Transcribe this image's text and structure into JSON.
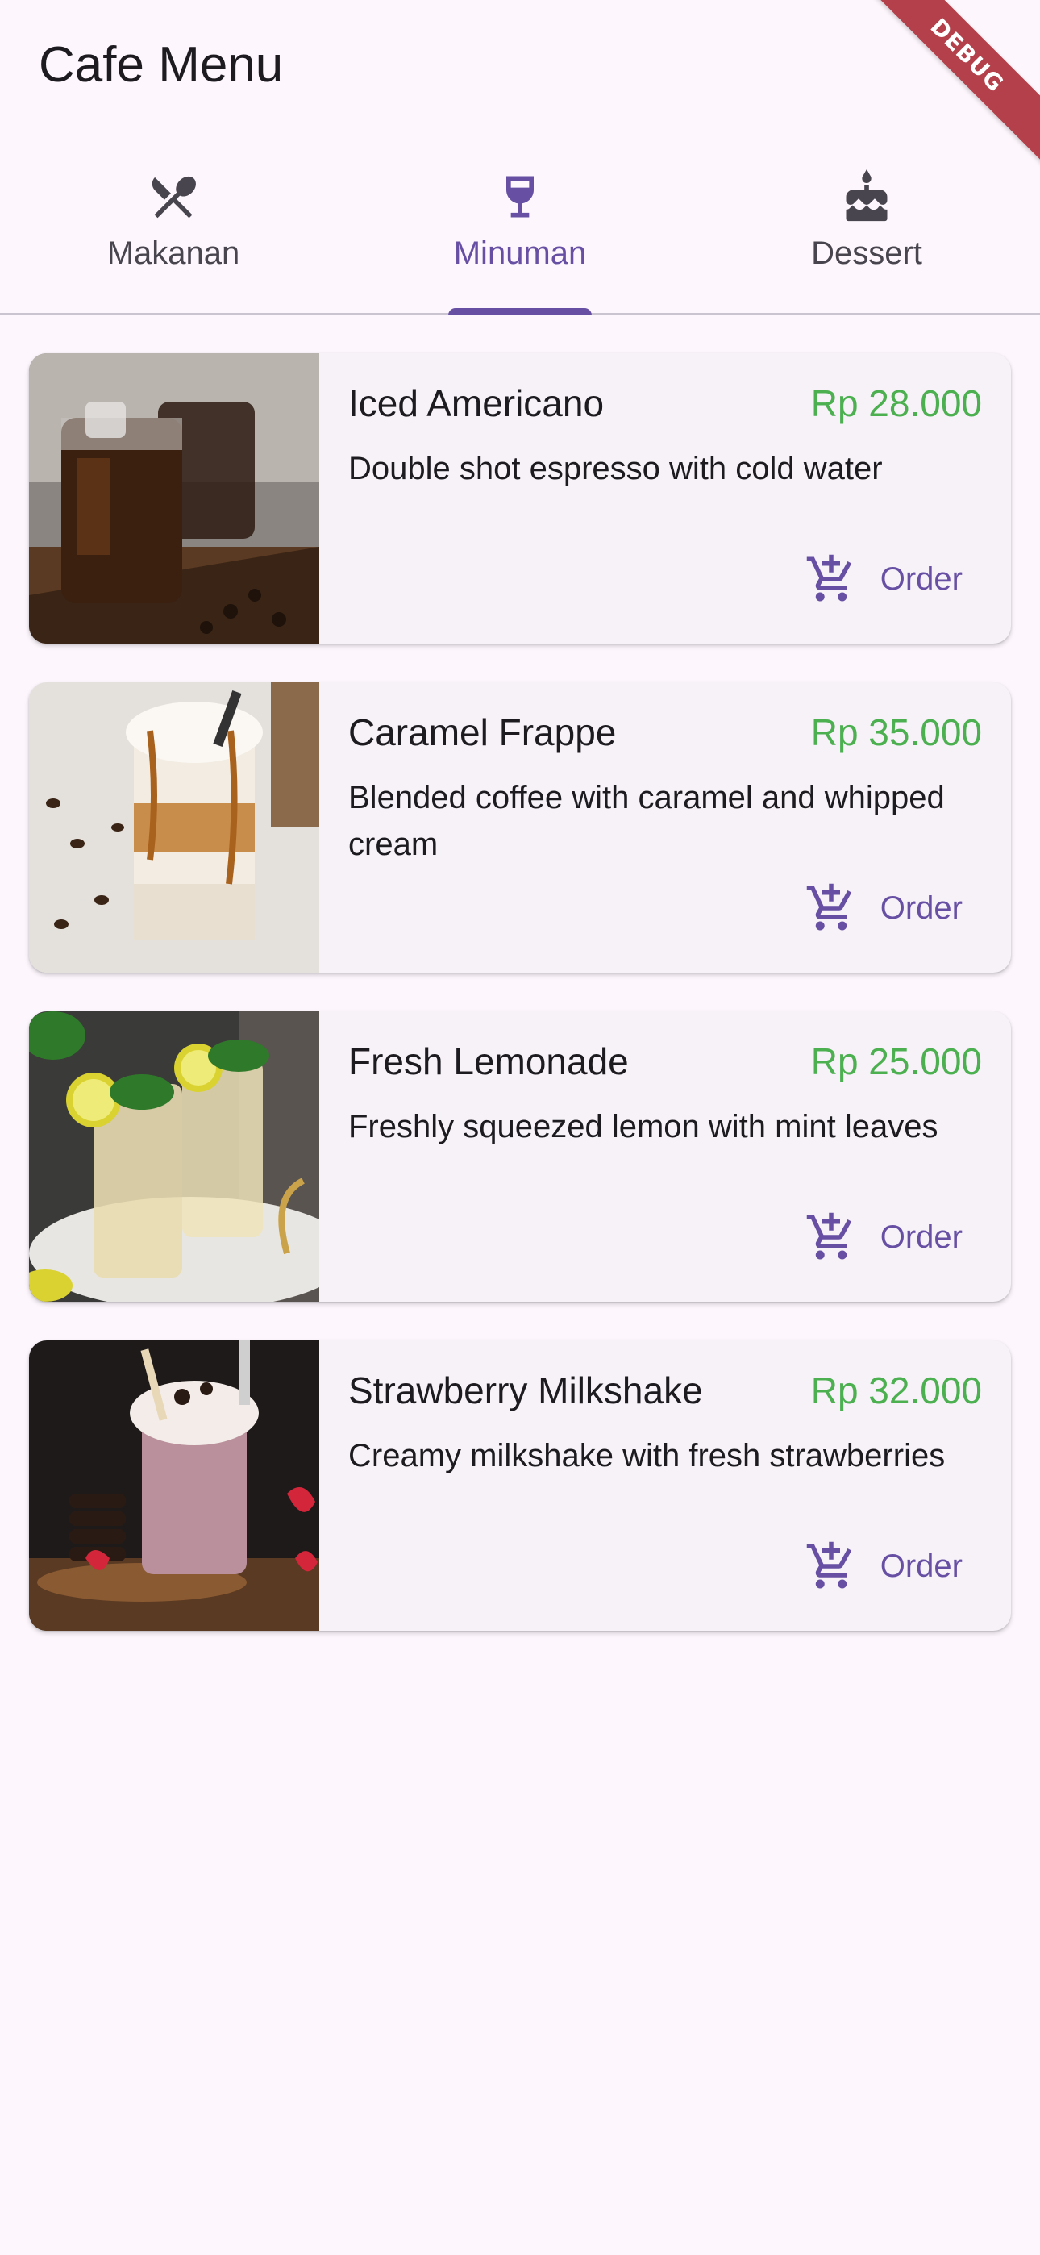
{
  "app": {
    "title": "Cafe Menu",
    "debug_banner": "DEBUG"
  },
  "colors": {
    "background": "#fdf7fd",
    "accent": "#6750a4",
    "price": "#4caf50",
    "card": "#f6f2f8",
    "debug": "#b3404a"
  },
  "tabs": [
    {
      "label": "Makanan",
      "icon": "fork-spoon-icon",
      "active": false
    },
    {
      "label": "Minuman",
      "icon": "wine-glass-icon",
      "active": true
    },
    {
      "label": "Dessert",
      "icon": "cake-icon",
      "active": false
    }
  ],
  "menu_items": [
    {
      "name": "Iced Americano",
      "price": "Rp 28.000",
      "description": "Double shot espresso with cold water",
      "order_label": "Order",
      "image": "iced-americano-photo"
    },
    {
      "name": "Caramel Frappe",
      "price": "Rp 35.000",
      "description": "Blended coffee with caramel and whipped cream",
      "order_label": "Order",
      "image": "caramel-frappe-photo"
    },
    {
      "name": "Fresh Lemonade",
      "price": "Rp 25.000",
      "description": "Freshly squeezed lemon with mint leaves",
      "order_label": "Order",
      "image": "lemonade-photo"
    },
    {
      "name": "Strawberry Milkshake",
      "price": "Rp 32.000",
      "description": "Creamy milkshake with fresh strawberries",
      "order_label": "Order",
      "image": "strawberry-milkshake-photo"
    }
  ]
}
